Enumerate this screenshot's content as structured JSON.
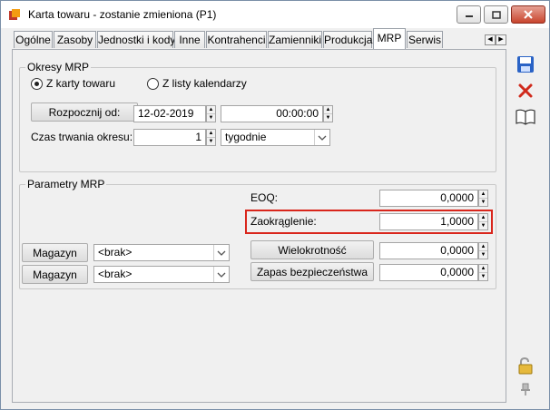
{
  "window": {
    "title": "Karta towaru - zostanie zmieniona (P1)"
  },
  "tabs": [
    {
      "label": "Ogólne"
    },
    {
      "label": "Zasoby"
    },
    {
      "label": "Jednostki i kody"
    },
    {
      "label": "Inne"
    },
    {
      "label": "Kontrahenci"
    },
    {
      "label": "Zamienniki"
    },
    {
      "label": "Produkcja"
    },
    {
      "label": "MRP"
    },
    {
      "label": "Serwis"
    }
  ],
  "active_tab": "MRP",
  "okresy": {
    "title": "Okresy MRP",
    "radio_karta": "Z karty towaru",
    "radio_listy": "Z listy kalendarzy",
    "selected": "Z karty towaru",
    "start_button": "Rozpocznij od:",
    "date": "12-02-2019",
    "time": "00:00:00",
    "duration_label": "Czas trwania okresu:",
    "duration_value": "1",
    "duration_unit": "tygodnie"
  },
  "parametry": {
    "title": "Parametry MRP",
    "eoq_label": "EOQ:",
    "eoq_value": "0,0000",
    "zaokraglenie_label": "Zaokrąglenie:",
    "zaokraglenie_value": "1,0000",
    "wielokrotnosc_button": "Wielokrotność",
    "wielokrotnosc_value": "0,0000",
    "zapas_button": "Zapas bezpieczeństwa",
    "zapas_value": "0,0000",
    "magazyn_button_1": "Magazyn",
    "magazyn_value_1": "<brak>",
    "magazyn_button_2": "Magazyn",
    "magazyn_value_2": "<brak>"
  },
  "colors": {
    "highlight": "#d9261c",
    "accent": "#1f5fbf"
  }
}
